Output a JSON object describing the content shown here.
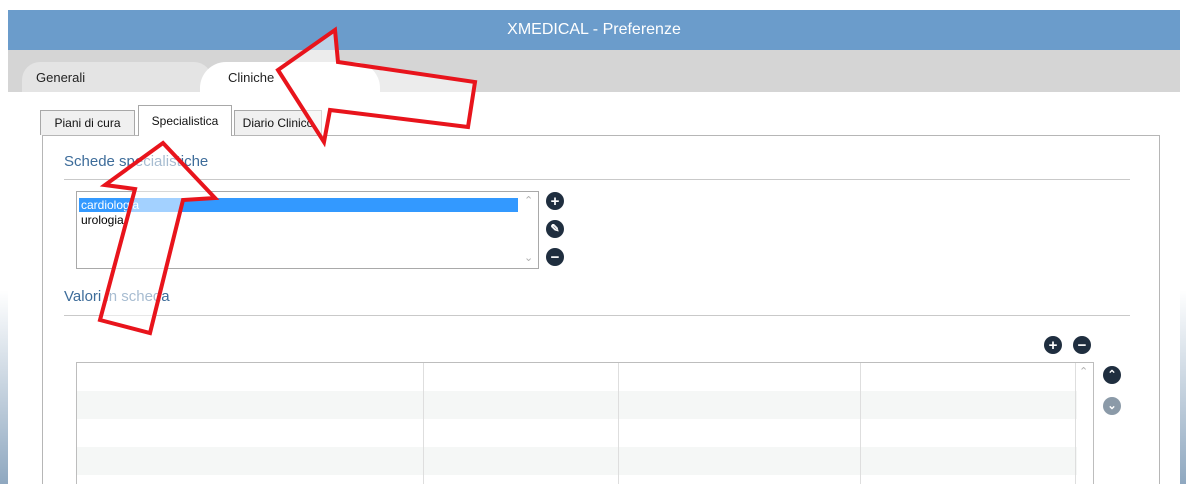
{
  "window": {
    "title": "XMEDICAL - Preferenze"
  },
  "main_tabs": [
    {
      "label": "Generali",
      "active": false
    },
    {
      "label": "Cliniche",
      "active": true
    }
  ],
  "sub_tabs": [
    {
      "label": "Piani di cura",
      "active": false
    },
    {
      "label": "Specialistica",
      "active": true
    },
    {
      "label": "Diario Clinico",
      "active": false
    }
  ],
  "schede": {
    "title": "Schede specialistiche",
    "items": [
      "cardiologia",
      "urologia"
    ],
    "selected_index": 0,
    "buttons": {
      "add": "plus-icon",
      "edit": "pencil-icon",
      "remove": "minus-icon"
    }
  },
  "valori": {
    "title": "Valori in scheda",
    "buttons": {
      "add": "plus-icon",
      "remove": "minus-icon",
      "up": "chevron-up-icon",
      "down": "chevron-down-icon"
    }
  },
  "colors": {
    "title_bar": "#6b9ccb",
    "selection": "#3399ff",
    "annotation_arrow": "#e8141c",
    "section_title": "#3d6c9a"
  }
}
